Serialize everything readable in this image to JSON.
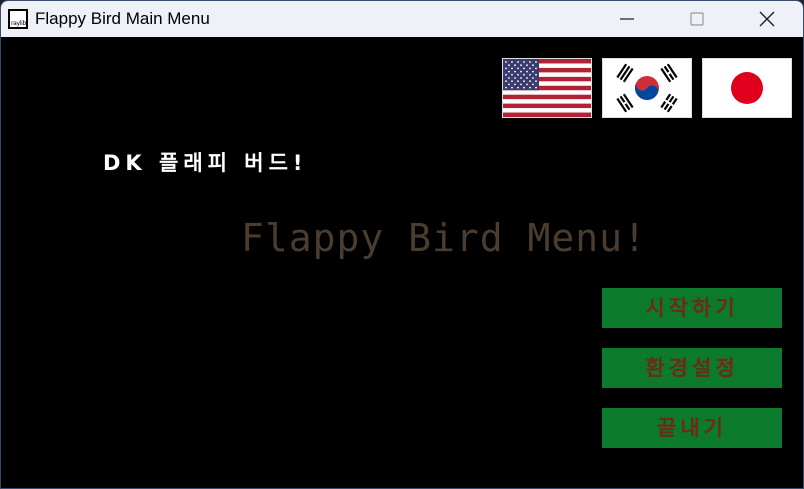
{
  "window": {
    "title": "Flappy Bird Main Menu",
    "icon_text": "raylib",
    "controls": [
      "minimize-icon",
      "maximize-icon",
      "close-icon"
    ]
  },
  "language_flags": [
    {
      "language": "English",
      "icon": "us-flag-icon"
    },
    {
      "language": "Korean",
      "icon": "korea-flag-icon"
    },
    {
      "language": "Japanese",
      "icon": "japan-flag-icon"
    }
  ],
  "game": {
    "title_ko": "DK 플래피 버드!",
    "menu_title": "Flappy Bird Menu!"
  },
  "menu": {
    "start_label": "시작하기",
    "settings_label": "환경설정",
    "exit_label": "끝내기"
  },
  "colors": {
    "background": "#000000",
    "button_bg": "#0b7a2c",
    "button_text": "#6e2a18",
    "menu_title": "#4a3d30",
    "game_title": "#ffffff"
  }
}
